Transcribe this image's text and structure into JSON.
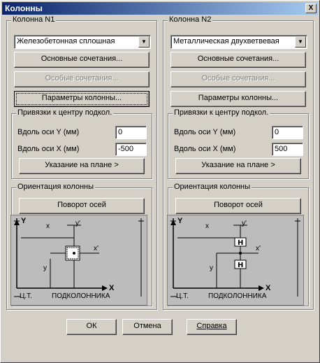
{
  "window": {
    "title": "Колонны",
    "close_glyph": "X"
  },
  "left": {
    "group_title": "Колонна N1",
    "type_value": "Железобетонная сплошная",
    "btn_basic": "Основные сочетания...",
    "btn_special": "Особые сочетания...",
    "btn_params": "Параметры колонны...",
    "bind_group": "Привязки к центру подкол.",
    "along_y_label": "Вдоль оси Y (мм)",
    "along_y_value": "0",
    "along_x_label": "Вдоль оси X (мм)",
    "along_x_value": "-500",
    "btn_plan": "Указание на плане >",
    "orient_group": "Ориентация колонны",
    "btn_rotate": "Поворот осей",
    "diagram": {
      "y_axis": "Y",
      "x_axis": "X",
      "x_small": "x",
      "y_prime": "y'",
      "x_prime": "x'",
      "y_small": "y",
      "ct": "Ц.Т.",
      "podk": "ПОДКОЛОННИКА"
    }
  },
  "right": {
    "group_title": "Колонна N2",
    "type_value": "Металлическая двухветвевая",
    "btn_basic": "Основные сочетания...",
    "btn_special": "Особые сочетания...",
    "btn_params": "Параметры колонны...",
    "bind_group": "Привязки к центру подкол.",
    "along_y_label": "Вдоль оси Y (мм)",
    "along_y_value": "0",
    "along_x_label": "Вдоль оси X (мм)",
    "along_x_value": "500",
    "btn_plan": "Указание на плане >",
    "orient_group": "Ориентация колонны",
    "btn_rotate": "Поворот осей",
    "diagram": {
      "y_axis": "Y",
      "x_axis": "X",
      "x_small": "x",
      "y_prime": "y'",
      "x_prime": "x'",
      "y_small": "y",
      "ct": "Ц.Т.",
      "podk": "ПОДКОЛОННИКА"
    }
  },
  "footer": {
    "ok": "ОК",
    "cancel": "Отмена",
    "help": "Справка"
  }
}
